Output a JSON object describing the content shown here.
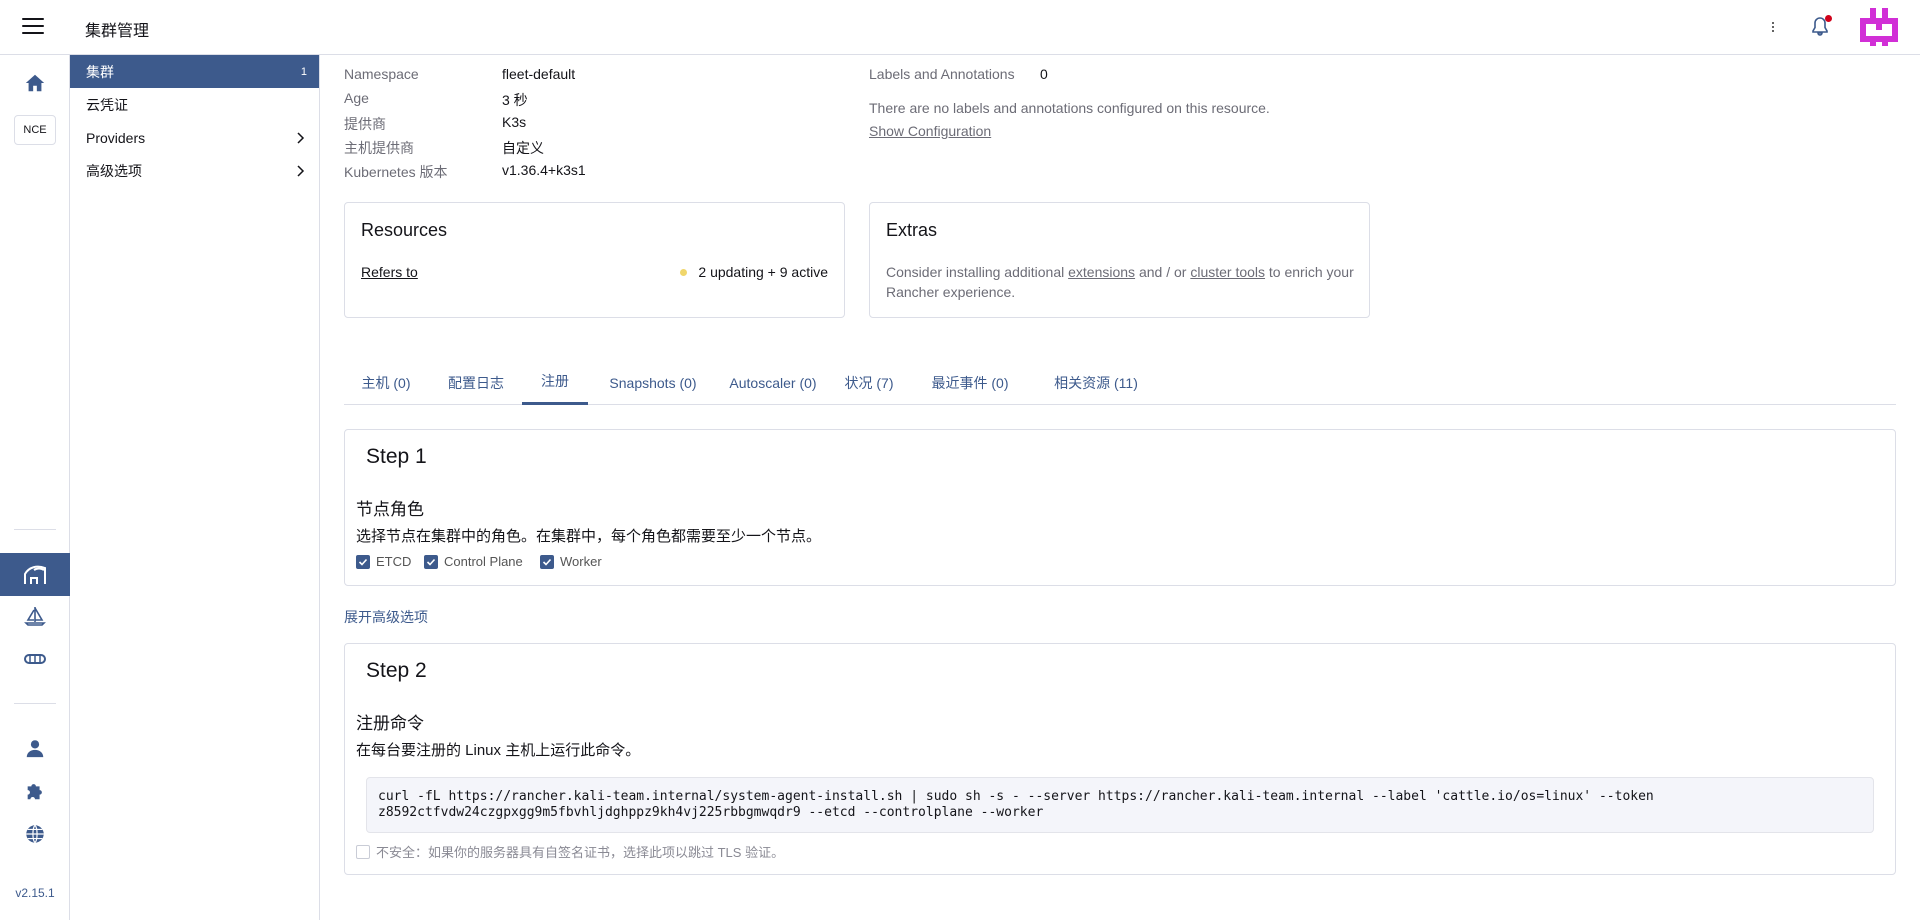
{
  "header": {
    "title": "集群管理"
  },
  "rail": {
    "nce_label": "NCE",
    "version": "v2.15.1"
  },
  "sidenav": {
    "items": [
      {
        "label": "集群",
        "count": "1"
      },
      {
        "label": "云凭证"
      },
      {
        "label": "Providers"
      },
      {
        "label": "高级选项"
      }
    ]
  },
  "details": {
    "namespace_label": "Namespace",
    "namespace_value": "fleet-default",
    "age_label": "Age",
    "age_value": "3 秒",
    "provider_label": "提供商",
    "provider_value": "K3s",
    "host_provider_label": "主机提供商",
    "host_provider_value": "自定义",
    "k8s_label": "Kubernetes 版本",
    "k8s_value": "v1.36.4+k3s1",
    "labels_label": "Labels and Annotations",
    "labels_value": "0",
    "labels_empty": "There are no labels and annotations configured on this resource.",
    "show_config": "Show Configuration"
  },
  "resources": {
    "title": "Resources",
    "refers_to": "Refers to",
    "status": "2 updating + 9 active",
    "status_color": "#f0d66b"
  },
  "extras": {
    "title": "Extras",
    "text_1": "Consider installing additional",
    "link_1": "extensions",
    "text_2": "and / or",
    "link_2": "cluster tools",
    "text_3": "to enrich your",
    "text_4": "Rancher experience."
  },
  "tabs": [
    {
      "label": "主机 (0)"
    },
    {
      "label": "配置日志"
    },
    {
      "label": "注册"
    },
    {
      "label": "Snapshots (0)"
    },
    {
      "label": "Autoscaler (0)"
    },
    {
      "label": "状况 (7)"
    },
    {
      "label": "最近事件 (0)"
    },
    {
      "label": "相关资源 (11)"
    }
  ],
  "step1": {
    "title": "Step 1",
    "heading": "节点角色",
    "desc": "选择节点在集群中的角色。在集群中，每个角色都需要至少一个节点。",
    "roles": [
      {
        "label": "ETCD",
        "checked": true
      },
      {
        "label": "Control Plane",
        "checked": true
      },
      {
        "label": "Worker",
        "checked": true
      }
    ]
  },
  "advanced_link": "展开高级选项",
  "step2": {
    "title": "Step 2",
    "heading": "注册命令",
    "desc": "在每台要注册的 Linux 主机上运行此命令。",
    "command_line1": "curl -fL https://rancher.kali-team.internal/system-agent-install.sh | sudo sh -s - --server https://rancher.kali-team.internal --label 'cattle.io/os=linux' --token",
    "command_line2": "z8592ctfvdw24czgpxgg9m5fbvhljdghppz9kh4vj225rbbgmwqdr9 --etcd --controlplane --worker",
    "insecure_label": "不安全：如果你的服务器具有自签名证书，选择此项以跳过 TLS 验证。"
  },
  "colors": {
    "accent": "#3d5a8c",
    "avatar": "#d12fd6",
    "notification": "#d0021b"
  }
}
